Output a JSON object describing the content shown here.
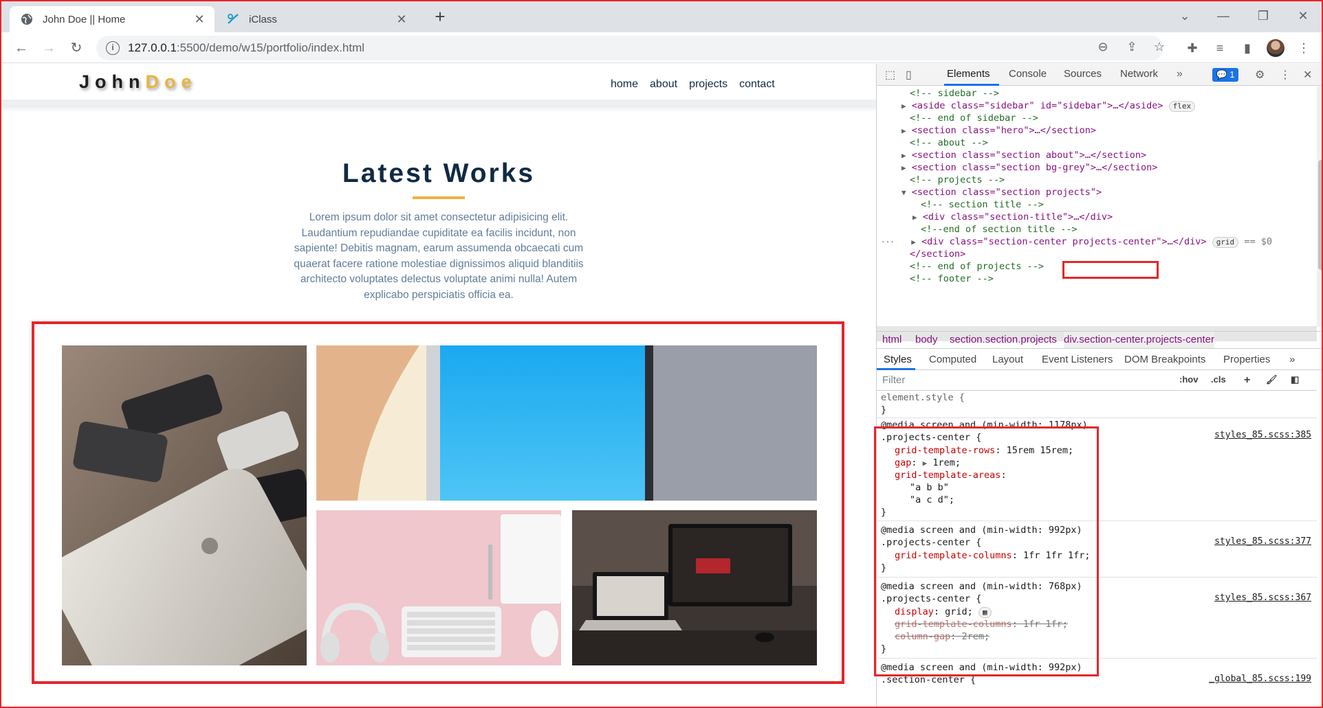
{
  "browser": {
    "tabs": [
      {
        "title": "John Doe || Home",
        "active": true
      },
      {
        "title": "iClass",
        "active": false
      }
    ],
    "url_host": "127.0.0.1",
    "url_path": ":5500/demo/w15/portfolio/index.html"
  },
  "site": {
    "logo_first": "John",
    "logo_last": "Doe",
    "nav_links": [
      "home",
      "about",
      "projects",
      "contact"
    ],
    "section_title": "Latest Works",
    "section_text": "Lorem ipsum dolor sit amet consectetur adipisicing elit. Laudantium repudiandae cupiditate ea facilis incidunt, non sapiente! Debitis magnam, earum assumenda obcaecati cum quaerat facere ratione molestiae dignissimos aliquid blanditiis architecto voluptates delectus voluptate animi nulla! Autem explicabo perspiciatis officia ea.",
    "accent_color": "#e9b440",
    "text_color": "#102a42"
  },
  "devtools": {
    "tabs": [
      "Elements",
      "Console",
      "Sources",
      "Network"
    ],
    "issues_count": "1",
    "dom_lines": [
      {
        "kind": "comment",
        "text": "<!-- sidebar -->"
      },
      {
        "kind": "tag",
        "text": "<aside class=\"sidebar\" id=\"sidebar\">…</aside>",
        "pill": "flex"
      },
      {
        "kind": "comment",
        "text": "<!-- end of sidebar -->"
      },
      {
        "kind": "tag",
        "text": "<section class=\"hero\">…</section>"
      },
      {
        "kind": "comment",
        "text": "<!-- about -->"
      },
      {
        "kind": "tag",
        "text": "<section class=\"section about\">…</section>"
      },
      {
        "kind": "tag",
        "text": "<section class=\"section bg-grey\">…</section>"
      },
      {
        "kind": "comment",
        "text": "<!-- projects -->"
      },
      {
        "kind": "tag",
        "text": "<section class=\"section projects\">"
      },
      {
        "kind": "comment",
        "text": "<!-- section title -->"
      },
      {
        "kind": "tag",
        "text": "<div class=\"section-title\">…</div>"
      },
      {
        "kind": "comment",
        "text": "<!--end of section title -->"
      },
      {
        "kind": "tag",
        "text": "<div class=\"section-center projects-center\">…</div>",
        "pill": "grid",
        "suffix": "== $0"
      },
      {
        "kind": "tag",
        "text": "</section>"
      },
      {
        "kind": "comment",
        "text": "<!-- end of projects -->"
      },
      {
        "kind": "comment",
        "text": "<!-- footer -->"
      }
    ],
    "breadcrumbs": [
      "html",
      "body",
      "section.section.projects",
      "div.section-center.projects-center"
    ],
    "subtabs": [
      "Styles",
      "Computed",
      "Layout",
      "Event Listeners",
      "DOM Breakpoints",
      "Properties"
    ],
    "filter_placeholder": "Filter",
    "filter_hov": ":hov",
    "filter_cls": ".cls",
    "styles": {
      "element_style": "element.style {",
      "rule1_media": "@media screen and (min-width: 1178px)",
      "rule1_selector": ".projects-center {",
      "rule1_source": "styles_85.scss:385",
      "rule1_decls": [
        {
          "prop": "grid-template-rows",
          "value": "15rem 15rem;"
        },
        {
          "prop": "gap",
          "value": "1rem;"
        },
        {
          "prop": "grid-template-areas",
          "value": ""
        }
      ],
      "rule1_areas": [
        "\"a b b\"",
        "\"a c d\";"
      ],
      "rule2_media": "@media screen and (min-width: 992px)",
      "rule2_selector": ".projects-center {",
      "rule2_source": "styles_85.scss:377",
      "rule2_decl": {
        "prop": "grid-template-columns",
        "value": "1fr 1fr 1fr;"
      },
      "rule3_media": "@media screen and (min-width: 768px)",
      "rule3_selector": ".projects-center {",
      "rule3_source": "styles_85.scss:367",
      "rule3_decls": [
        {
          "prop": "display",
          "value": "grid;"
        },
        {
          "prop": "grid-template-columns",
          "value": "1fr 1fr;"
        },
        {
          "prop": "column-gap",
          "value": "2rem;"
        }
      ],
      "rule4_media": "@media screen and (min-width: 992px)",
      "rule4_selector": ".section-center {",
      "rule4_source": "_global_85.scss:199",
      "close": "}"
    }
  }
}
